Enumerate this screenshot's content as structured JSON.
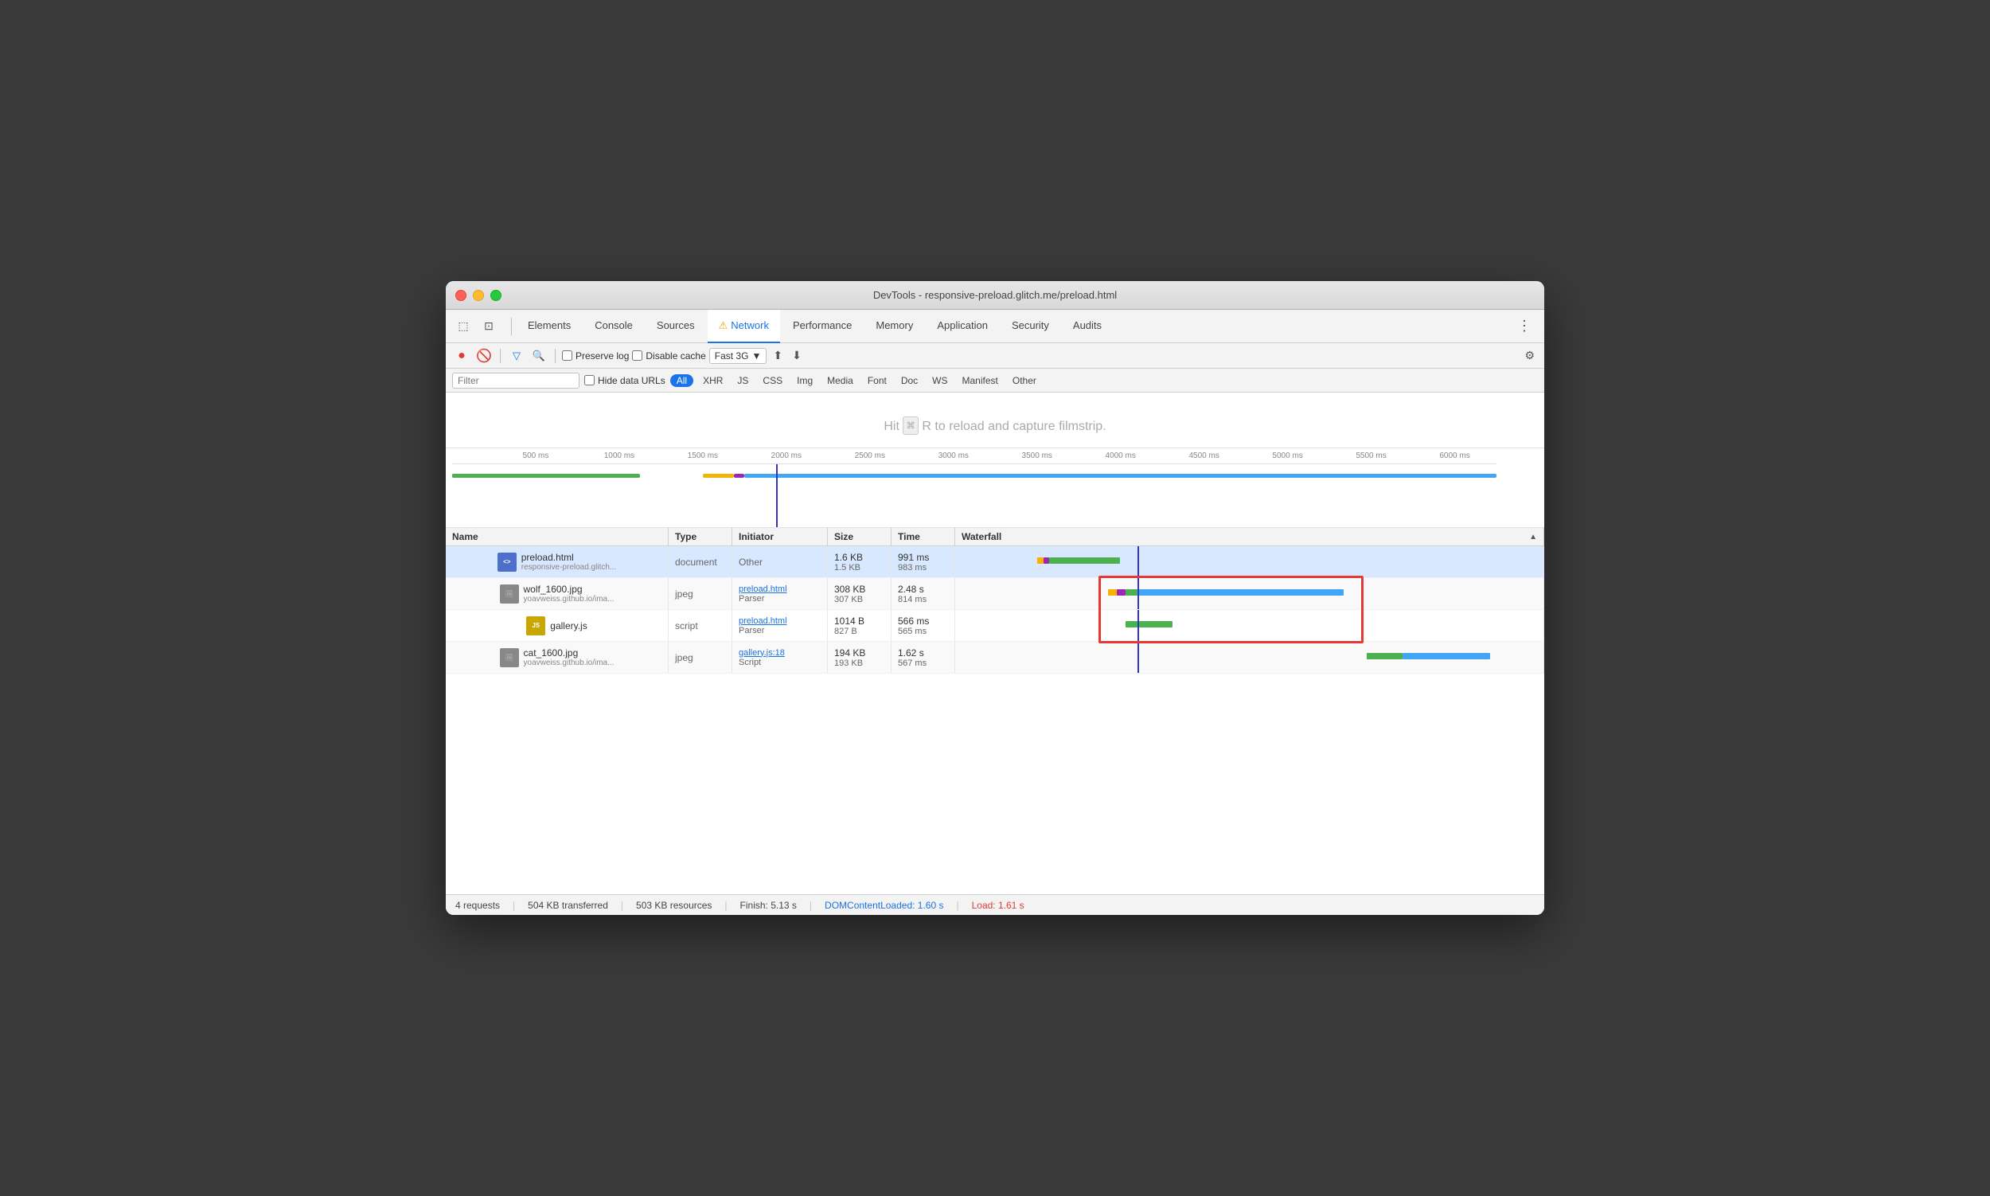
{
  "window": {
    "title": "DevTools - responsive-preload.glitch.me/preload.html"
  },
  "tabs": [
    {
      "id": "elements",
      "label": "Elements",
      "active": false
    },
    {
      "id": "console",
      "label": "Console",
      "active": false
    },
    {
      "id": "sources",
      "label": "Sources",
      "active": false
    },
    {
      "id": "network",
      "label": "Network",
      "active": true,
      "warning": true
    },
    {
      "id": "performance",
      "label": "Performance",
      "active": false
    },
    {
      "id": "memory",
      "label": "Memory",
      "active": false
    },
    {
      "id": "application",
      "label": "Application",
      "active": false
    },
    {
      "id": "security",
      "label": "Security",
      "active": false
    },
    {
      "id": "audits",
      "label": "Audits",
      "active": false
    }
  ],
  "toolbar": {
    "preserve_log_label": "Preserve log",
    "disable_cache_label": "Disable cache",
    "throttle_label": "Fast 3G"
  },
  "filter": {
    "placeholder": "Filter",
    "hide_data_urls_label": "Hide data URLs",
    "buttons": [
      "All",
      "XHR",
      "JS",
      "CSS",
      "Img",
      "Media",
      "Font",
      "Doc",
      "WS",
      "Manifest",
      "Other"
    ]
  },
  "filmstrip": {
    "message": "Hit ⌘ R to reload and capture filmstrip."
  },
  "timeline": {
    "labels": [
      "500 ms",
      "1000 ms",
      "1500 ms",
      "2000 ms",
      "2500 ms",
      "3000 ms",
      "3500 ms",
      "4000 ms",
      "4500 ms",
      "5000 ms",
      "5500 ms",
      "6000 ms"
    ]
  },
  "table": {
    "headers": [
      "Name",
      "Type",
      "Initiator",
      "Size",
      "Time",
      "Waterfall"
    ],
    "rows": [
      {
        "id": "row-1",
        "selected": true,
        "name": "preload.html",
        "url": "responsive-preload.glitch...",
        "type": "document",
        "initiator": "Other",
        "initiator_link": false,
        "size_main": "1.6 KB",
        "size_sub": "1.5 KB",
        "time_main": "991 ms",
        "time_sub": "983 ms"
      },
      {
        "id": "row-2",
        "selected": false,
        "name": "wolf_1600.jpg",
        "url": "yoavweiss.github.io/ima...",
        "type": "jpeg",
        "initiator": "preload.html",
        "initiator_sub": "Parser",
        "initiator_link": true,
        "size_main": "308 KB",
        "size_sub": "307 KB",
        "time_main": "2.48 s",
        "time_sub": "814 ms"
      },
      {
        "id": "row-3",
        "selected": false,
        "name": "gallery.js",
        "url": "",
        "type": "script",
        "initiator": "preload.html",
        "initiator_sub": "Parser",
        "initiator_link": true,
        "size_main": "1014 B",
        "size_sub": "827 B",
        "time_main": "566 ms",
        "time_sub": "565 ms"
      },
      {
        "id": "row-4",
        "selected": false,
        "name": "cat_1600.jpg",
        "url": "yoavweiss.github.io/ima...",
        "type": "jpeg",
        "initiator": "gallery.js:18",
        "initiator_sub": "Script",
        "initiator_link": true,
        "size_main": "194 KB",
        "size_sub": "193 KB",
        "time_main": "1.62 s",
        "time_sub": "567 ms"
      }
    ]
  },
  "statusbar": {
    "requests": "4 requests",
    "transferred": "504 KB transferred",
    "resources": "503 KB resources",
    "finish": "Finish: 5.13 s",
    "dom_content_loaded": "DOMContentLoaded: 1.60 s",
    "load": "Load: 1.61 s"
  }
}
